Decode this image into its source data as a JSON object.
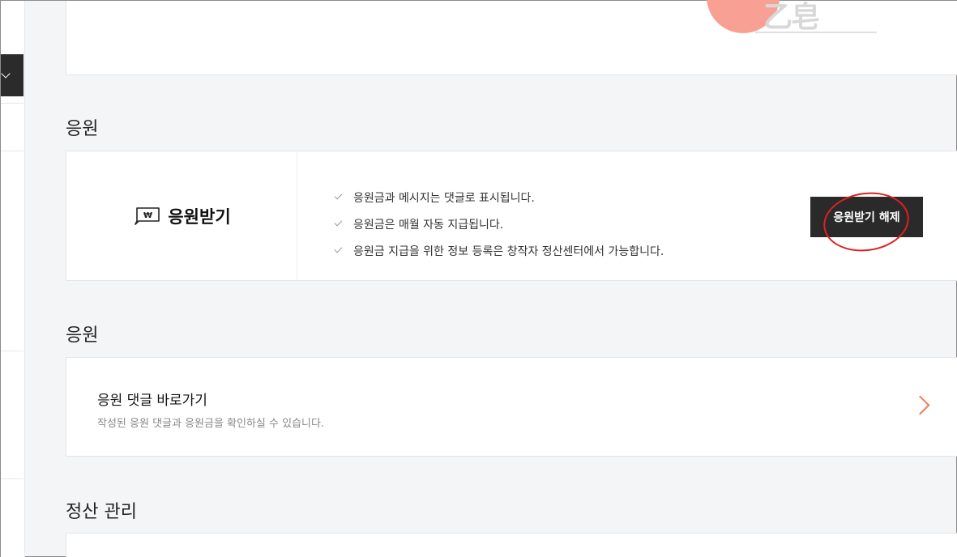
{
  "top_card": {
    "art_text": "乙皂"
  },
  "support_section": {
    "title": "응원",
    "card_title": "응원받기",
    "checks": [
      "응원금과 메시지는 댓글로 표시됩니다.",
      "응원금은 매월 자동 지급됩니다.",
      "응원금 지급을 위한 정보 등록은 창작자 정산센터에서 가능합니다."
    ],
    "release_button_label": "응원받기 해제"
  },
  "comments_section": {
    "title": "응원",
    "link_title": "응원 댓글 바로가기",
    "link_desc": "작성된 응원 댓글과 응원금을 확인하실 수 있습니다."
  },
  "settlement_section": {
    "title": "정산 관리"
  },
  "colors": {
    "accent_chevron": "#f07a5a",
    "annotation_circle": "#e02020",
    "button_bg": "#2a2a2a"
  }
}
